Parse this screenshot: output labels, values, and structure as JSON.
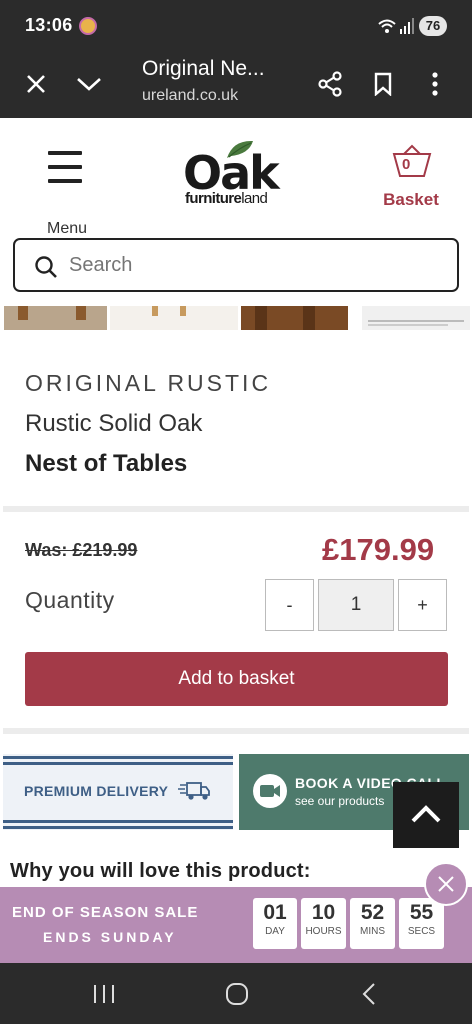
{
  "status_bar": {
    "time": "13:06",
    "battery": "76"
  },
  "browser": {
    "tab_title": "Original Ne...",
    "url": "ureland.co.uk"
  },
  "header": {
    "menu_label": "Menu",
    "logo_main": "Oak",
    "logo_sub_bold": "furniture",
    "logo_sub_light": "land",
    "basket_count": "0",
    "basket_label": "Basket"
  },
  "search": {
    "placeholder": "Search"
  },
  "product": {
    "brand": "ORIGINAL RUSTIC",
    "name_line1": "Rustic Solid Oak",
    "name_line2": "Nest of Tables",
    "was_price": "Was: £219.99",
    "price": "£179.99",
    "quantity_label": "Quantity",
    "quantity_minus": "-",
    "quantity_value": "1",
    "quantity_plus": "+",
    "add_to_basket": "Add to basket"
  },
  "promos": {
    "delivery_label": "PREMIUM DELIVERY",
    "video_title": "BOOK A VIDEO CALL",
    "video_subtitle": "see our products"
  },
  "section": {
    "why_heading": "Why you will love this product:"
  },
  "sale": {
    "line1": "END OF SEASON SALE",
    "line2": "ENDS SUNDAY",
    "countdown": [
      {
        "value": "01",
        "unit": "DAY"
      },
      {
        "value": "10",
        "unit": "HOURS"
      },
      {
        "value": "52",
        "unit": "MINS"
      },
      {
        "value": "55",
        "unit": "SECS"
      }
    ]
  },
  "colors": {
    "brand": "#a33a48",
    "delivery": "#3e5f86",
    "video": "#4e7a6c",
    "sale": "#b68cb4"
  }
}
